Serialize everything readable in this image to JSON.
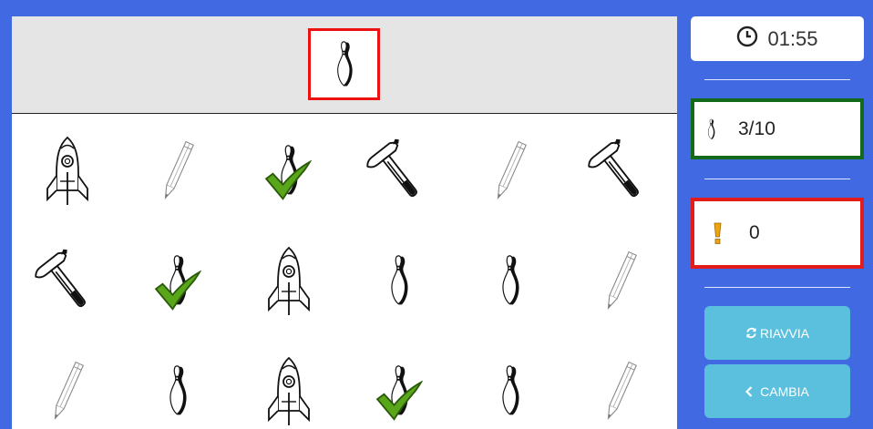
{
  "timer": {
    "value": "01:55",
    "icon": "clock-icon"
  },
  "score": {
    "value": "3/10",
    "icon": "bowling-pin-icon"
  },
  "errors": {
    "value": "0",
    "icon": "exclamation-icon"
  },
  "buttons": {
    "restart": "RIAVVIA",
    "change": "CAMBIA"
  },
  "target": "pin",
  "grid": [
    [
      "rocket",
      "pencil",
      "pin-check",
      "hammer",
      "pencil",
      "hammer"
    ],
    [
      "hammer",
      "pin-check",
      "rocket",
      "pin",
      "pin",
      "pencil"
    ],
    [
      "pencil",
      "pin",
      "rocket",
      "pin-check",
      "pin",
      "pencil"
    ]
  ],
  "colors": {
    "background": "#4169e1",
    "target_border": "#ee1111",
    "score_border": "#136a1b",
    "errors_border": "#e21b1b",
    "button": "#5bc0de",
    "check": "#5aa61a",
    "exclamation": "#f0a30a"
  }
}
